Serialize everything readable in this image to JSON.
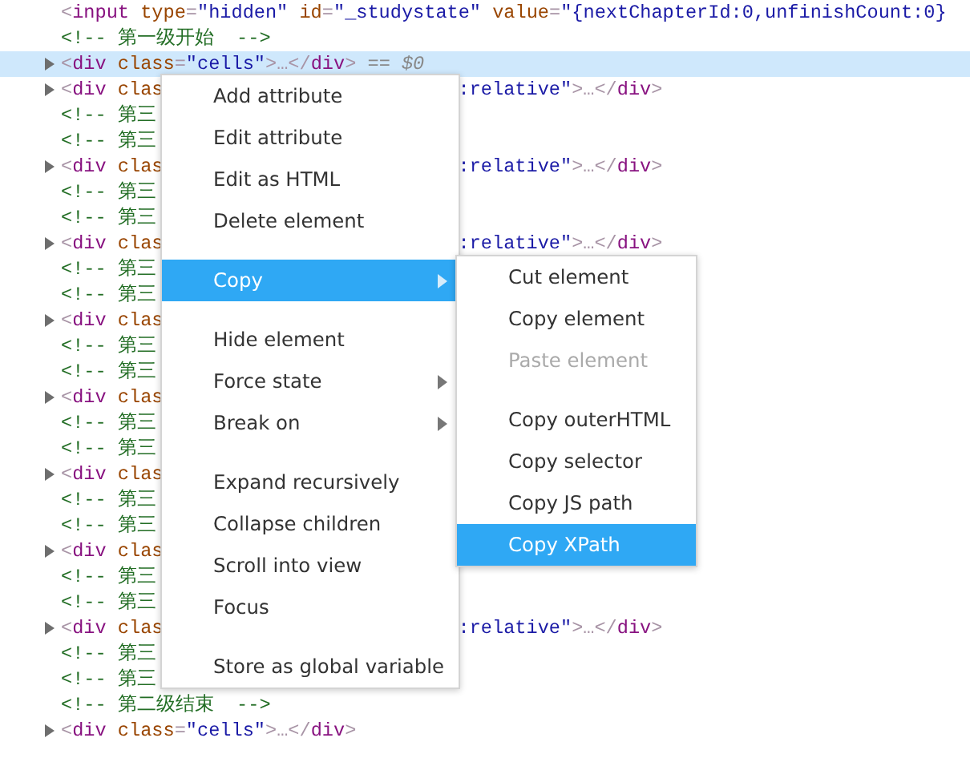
{
  "code_lines": [
    {
      "has_toggle": false,
      "selected": false,
      "left": [
        {
          "kind": "punct",
          "text": "<"
        },
        {
          "kind": "tag",
          "text": "input"
        },
        {
          "kind": "attr",
          "text": " type"
        },
        {
          "kind": "punct",
          "text": "="
        },
        {
          "kind": "value",
          "text": "\"hidden\""
        },
        {
          "kind": "attr",
          "text": " id"
        },
        {
          "kind": "punct",
          "text": "="
        },
        {
          "kind": "value",
          "text": "\"_studystate\""
        },
        {
          "kind": "attr",
          "text": " value"
        },
        {
          "kind": "punct",
          "text": "="
        },
        {
          "kind": "value",
          "text": "\"{nextChapterId:0,unfinishCount:0}"
        }
      ]
    },
    {
      "has_toggle": false,
      "selected": false,
      "left": [
        {
          "kind": "comment",
          "text": "<!-- 第一级开始  -->"
        }
      ]
    },
    {
      "has_toggle": true,
      "selected": true,
      "left": [
        {
          "kind": "punct",
          "text": "<"
        },
        {
          "kind": "tag",
          "text": "div"
        },
        {
          "kind": "attr",
          "text": " class"
        },
        {
          "kind": "punct",
          "text": "="
        },
        {
          "kind": "value",
          "text": "\"cells\""
        },
        {
          "kind": "punct",
          "text": ">…</"
        },
        {
          "kind": "tag",
          "text": "div"
        },
        {
          "kind": "punct",
          "text": ">"
        },
        {
          "kind": "marker",
          "text": " == $0"
        }
      ]
    },
    {
      "has_toggle": true,
      "selected": false,
      "left": [
        {
          "kind": "punct",
          "text": "<"
        },
        {
          "kind": "tag",
          "text": "div"
        },
        {
          "kind": "attr",
          "text": " clas"
        }
      ],
      "right": [
        {
          "kind": "value",
          "text": ":relative\""
        },
        {
          "kind": "punct",
          "text": ">…</"
        },
        {
          "kind": "tag",
          "text": "div"
        },
        {
          "kind": "punct",
          "text": ">"
        }
      ]
    },
    {
      "has_toggle": false,
      "selected": false,
      "left": [
        {
          "kind": "comment",
          "text": "<!-- 第三"
        }
      ]
    },
    {
      "has_toggle": false,
      "selected": false,
      "left": [
        {
          "kind": "comment",
          "text": "<!-- 第三"
        }
      ]
    },
    {
      "has_toggle": true,
      "selected": false,
      "left": [
        {
          "kind": "punct",
          "text": "<"
        },
        {
          "kind": "tag",
          "text": "div"
        },
        {
          "kind": "attr",
          "text": " clas"
        }
      ],
      "right": [
        {
          "kind": "value",
          "text": ":relative\""
        },
        {
          "kind": "punct",
          "text": ">…</"
        },
        {
          "kind": "tag",
          "text": "div"
        },
        {
          "kind": "punct",
          "text": ">"
        }
      ]
    },
    {
      "has_toggle": false,
      "selected": false,
      "left": [
        {
          "kind": "comment",
          "text": "<!-- 第三"
        }
      ]
    },
    {
      "has_toggle": false,
      "selected": false,
      "left": [
        {
          "kind": "comment",
          "text": "<!-- 第三"
        }
      ]
    },
    {
      "has_toggle": true,
      "selected": false,
      "left": [
        {
          "kind": "punct",
          "text": "<"
        },
        {
          "kind": "tag",
          "text": "div"
        },
        {
          "kind": "attr",
          "text": " clas"
        }
      ],
      "right": [
        {
          "kind": "value",
          "text": ":relative\""
        },
        {
          "kind": "punct",
          "text": ">…</"
        },
        {
          "kind": "tag",
          "text": "div"
        },
        {
          "kind": "punct",
          "text": ">"
        }
      ]
    },
    {
      "has_toggle": false,
      "selected": false,
      "left": [
        {
          "kind": "comment",
          "text": "<!-- 第三"
        }
      ]
    },
    {
      "has_toggle": false,
      "selected": false,
      "left": [
        {
          "kind": "comment",
          "text": "<!-- 第三"
        }
      ]
    },
    {
      "has_toggle": true,
      "selected": false,
      "left": [
        {
          "kind": "punct",
          "text": "<"
        },
        {
          "kind": "tag",
          "text": "div"
        },
        {
          "kind": "attr",
          "text": " clas"
        }
      ]
    },
    {
      "has_toggle": false,
      "selected": false,
      "left": [
        {
          "kind": "comment",
          "text": "<!-- 第三"
        }
      ]
    },
    {
      "has_toggle": false,
      "selected": false,
      "left": [
        {
          "kind": "comment",
          "text": "<!-- 第三"
        }
      ]
    },
    {
      "has_toggle": true,
      "selected": false,
      "left": [
        {
          "kind": "punct",
          "text": "<"
        },
        {
          "kind": "tag",
          "text": "div"
        },
        {
          "kind": "attr",
          "text": " clas"
        }
      ]
    },
    {
      "has_toggle": false,
      "selected": false,
      "left": [
        {
          "kind": "comment",
          "text": "<!-- 第三"
        }
      ]
    },
    {
      "has_toggle": false,
      "selected": false,
      "left": [
        {
          "kind": "comment",
          "text": "<!-- 第三"
        }
      ]
    },
    {
      "has_toggle": true,
      "selected": false,
      "left": [
        {
          "kind": "punct",
          "text": "<"
        },
        {
          "kind": "tag",
          "text": "div"
        },
        {
          "kind": "attr",
          "text": " clas"
        }
      ]
    },
    {
      "has_toggle": false,
      "selected": false,
      "left": [
        {
          "kind": "comment",
          "text": "<!-- 第三"
        }
      ]
    },
    {
      "has_toggle": false,
      "selected": false,
      "left": [
        {
          "kind": "comment",
          "text": "<!-- 第三"
        }
      ]
    },
    {
      "has_toggle": true,
      "selected": false,
      "left": [
        {
          "kind": "punct",
          "text": "<"
        },
        {
          "kind": "tag",
          "text": "div"
        },
        {
          "kind": "attr",
          "text": " clas"
        }
      ]
    },
    {
      "has_toggle": false,
      "selected": false,
      "left": [
        {
          "kind": "comment",
          "text": "<!-- 第三"
        }
      ]
    },
    {
      "has_toggle": false,
      "selected": false,
      "left": [
        {
          "kind": "comment",
          "text": "<!-- 第三"
        }
      ]
    },
    {
      "has_toggle": true,
      "selected": false,
      "left": [
        {
          "kind": "punct",
          "text": "<"
        },
        {
          "kind": "tag",
          "text": "div"
        },
        {
          "kind": "attr",
          "text": " clas"
        }
      ],
      "right": [
        {
          "kind": "value",
          "text": ":relative\""
        },
        {
          "kind": "punct",
          "text": ">…</"
        },
        {
          "kind": "tag",
          "text": "div"
        },
        {
          "kind": "punct",
          "text": ">"
        }
      ]
    },
    {
      "has_toggle": false,
      "selected": false,
      "left": [
        {
          "kind": "comment",
          "text": "<!-- 第三"
        }
      ]
    },
    {
      "has_toggle": false,
      "selected": false,
      "left": [
        {
          "kind": "comment",
          "text": "<!-- 第三"
        }
      ]
    },
    {
      "has_toggle": false,
      "selected": false,
      "left": [
        {
          "kind": "comment",
          "text": "<!-- 第二级结束  -->"
        }
      ]
    },
    {
      "has_toggle": true,
      "selected": false,
      "left": [
        {
          "kind": "punct",
          "text": "<"
        },
        {
          "kind": "tag",
          "text": "div"
        },
        {
          "kind": "attr",
          "text": " class"
        },
        {
          "kind": "punct",
          "text": "="
        },
        {
          "kind": "value",
          "text": "\"cells\""
        },
        {
          "kind": "punct",
          "text": ">…</"
        },
        {
          "kind": "tag",
          "text": "div"
        },
        {
          "kind": "punct",
          "text": ">"
        }
      ]
    }
  ],
  "context_menu": [
    {
      "kind": "item",
      "label": "Add attribute",
      "selected": false,
      "disabled": false,
      "submenu": false
    },
    {
      "kind": "item",
      "label": "Edit attribute",
      "selected": false,
      "disabled": false,
      "submenu": false
    },
    {
      "kind": "item",
      "label": "Edit as HTML",
      "selected": false,
      "disabled": false,
      "submenu": false
    },
    {
      "kind": "item",
      "label": "Delete element",
      "selected": false,
      "disabled": false,
      "submenu": false
    },
    {
      "kind": "separator"
    },
    {
      "kind": "item",
      "label": "Copy",
      "selected": true,
      "disabled": false,
      "submenu": true
    },
    {
      "kind": "separator"
    },
    {
      "kind": "item",
      "label": "Hide element",
      "selected": false,
      "disabled": false,
      "submenu": false
    },
    {
      "kind": "item",
      "label": "Force state",
      "selected": false,
      "disabled": false,
      "submenu": true
    },
    {
      "kind": "item",
      "label": "Break on",
      "selected": false,
      "disabled": false,
      "submenu": true
    },
    {
      "kind": "separator"
    },
    {
      "kind": "item",
      "label": "Expand recursively",
      "selected": false,
      "disabled": false,
      "submenu": false
    },
    {
      "kind": "item",
      "label": "Collapse children",
      "selected": false,
      "disabled": false,
      "submenu": false
    },
    {
      "kind": "item",
      "label": "Scroll into view",
      "selected": false,
      "disabled": false,
      "submenu": false
    },
    {
      "kind": "item",
      "label": "Focus",
      "selected": false,
      "disabled": false,
      "submenu": false
    },
    {
      "kind": "separator"
    },
    {
      "kind": "item",
      "label": "Store as global variable",
      "selected": false,
      "disabled": false,
      "submenu": false
    }
  ],
  "copy_submenu": [
    {
      "kind": "item",
      "label": "Cut element",
      "selected": false,
      "disabled": false,
      "submenu": false
    },
    {
      "kind": "item",
      "label": "Copy element",
      "selected": false,
      "disabled": false,
      "submenu": false
    },
    {
      "kind": "item",
      "label": "Paste element",
      "selected": false,
      "disabled": true,
      "submenu": false
    },
    {
      "kind": "separator"
    },
    {
      "kind": "item",
      "label": "Copy outerHTML",
      "selected": false,
      "disabled": false,
      "submenu": false
    },
    {
      "kind": "item",
      "label": "Copy selector",
      "selected": false,
      "disabled": false,
      "submenu": false
    },
    {
      "kind": "item",
      "label": "Copy JS path",
      "selected": false,
      "disabled": false,
      "submenu": false
    },
    {
      "kind": "item",
      "label": "Copy XPath",
      "selected": true,
      "disabled": false,
      "submenu": false
    }
  ]
}
